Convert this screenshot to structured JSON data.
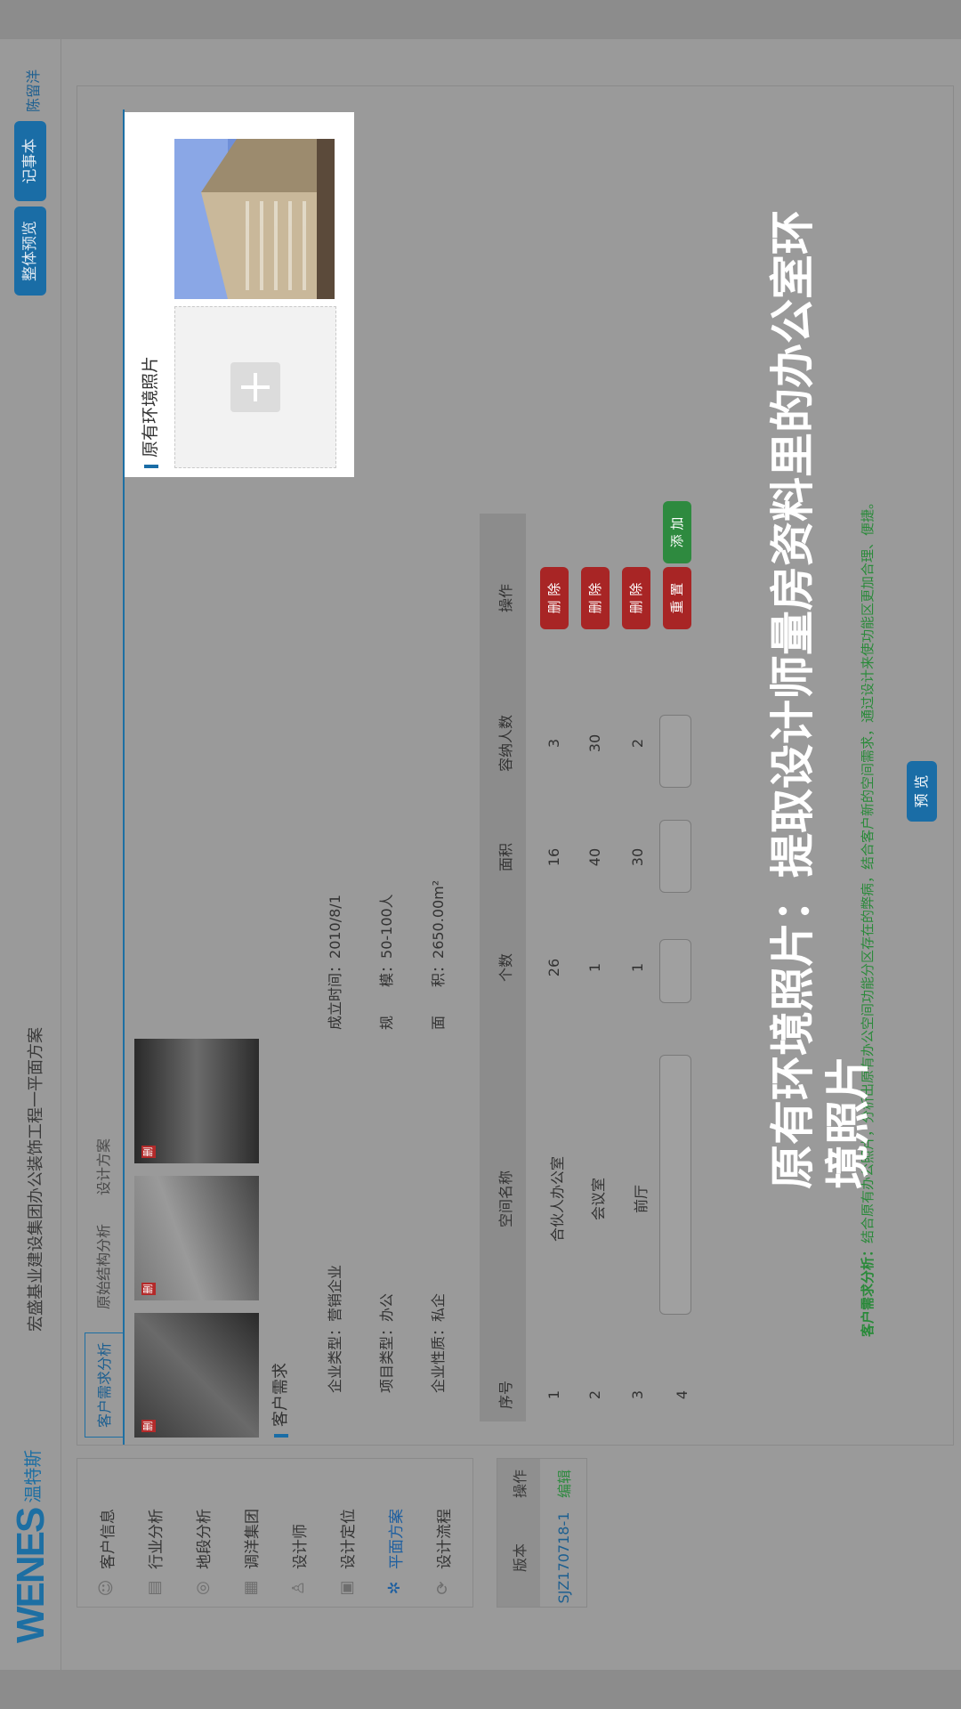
{
  "header": {
    "logo_text": "WENES",
    "logo_sub": "温特斯",
    "title": "宏盛基业建设集团办公装饰工程一平面方案",
    "btn_preview_all": "整体预览",
    "btn_notebook": "记事本",
    "user_name": "陈留洋"
  },
  "sidebar": {
    "items": [
      {
        "label": "客户信息",
        "icon": "user-icon"
      },
      {
        "label": "行业分析",
        "icon": "chart-icon"
      },
      {
        "label": "地段分析",
        "icon": "location-icon"
      },
      {
        "label": "调洋集团",
        "icon": "building-icon"
      },
      {
        "label": "设计师",
        "icon": "designer-icon"
      },
      {
        "label": "设计定位",
        "icon": "doc-icon"
      },
      {
        "label": "平面方案",
        "icon": "layout-icon",
        "active": true
      },
      {
        "label": "设计流程",
        "icon": "flow-icon"
      }
    ]
  },
  "version_table": {
    "headers": [
      "版本",
      "操作"
    ],
    "row": {
      "version": "SJZ170718-1",
      "action": "编辑"
    }
  },
  "tabs": [
    "客户需求分析",
    "原始结构分析",
    "设计方案"
  ],
  "photo_delete_label": "删",
  "customer_needs": {
    "section_title": "客户需求",
    "enterprise_type_label": "企业类型：",
    "enterprise_type": "营销企业",
    "project_type_label": "项目类型：",
    "project_type": "办公",
    "enterprise_nature_label": "企业性质：",
    "enterprise_nature": "私企",
    "founded_label": "成立时间：",
    "founded": "2010/8/1",
    "scale_label": "规　　模：",
    "scale": "50-100人",
    "area_label": "面　　积：",
    "area": "2650.00m²"
  },
  "req_table": {
    "headers": [
      "序号",
      "空间名称",
      "个数",
      "面积",
      "容纳人数",
      "操作"
    ],
    "rows": [
      {
        "no": "1",
        "name": "合伙人办公室",
        "count": "26",
        "area": "16",
        "capacity": "3",
        "action": "删 除"
      },
      {
        "no": "2",
        "name": "会议室",
        "count": "1",
        "area": "40",
        "capacity": "30",
        "action": "删 除"
      },
      {
        "no": "3",
        "name": "前厅",
        "count": "1",
        "area": "30",
        "capacity": "2",
        "action": "删 除"
      }
    ],
    "new_row_no": "4",
    "btn_reset": "重 置",
    "btn_add": "添 加"
  },
  "btn_preview": "预 览",
  "hint": {
    "label": "客户需求分析：",
    "text": "结合原有办公照片，分析出原有办公空间功能分区存在的弊病，结合客户新的空间需求，通过设计来使功能区更加合理、便捷。"
  },
  "env_panel": {
    "title": "原有环境照片"
  },
  "overlay": {
    "text": "原有环境照片：提取设计师量房资料里的办公室环境照片"
  },
  "colors": {
    "accent": "#1a6da6",
    "danger": "#a82525",
    "success": "#2e8a3f"
  }
}
